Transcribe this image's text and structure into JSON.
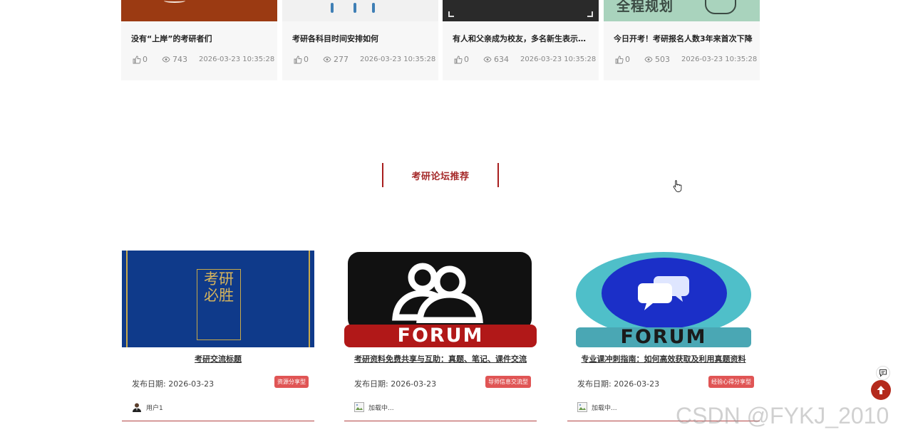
{
  "news": [
    {
      "title": "没有“上岸”的考研者们",
      "likes": "0",
      "views": "743",
      "date": "2026-03-23 10:35:28"
    },
    {
      "title": "考研各科目时间安排如何",
      "likes": "0",
      "views": "277",
      "date": "2026-03-23 10:35:28"
    },
    {
      "title": "有人和父亲成为校友，多名新生表示要...",
      "likes": "0",
      "views": "634",
      "date": "2026-03-23 10:35:28"
    },
    {
      "title": "今日开考！考研报名人数3年来首次下降",
      "likes": "0",
      "views": "503",
      "date": "2026-03-23 10:35:28"
    }
  ],
  "news_thumb_text": "全程规划",
  "section": {
    "title": "考研论坛推荐"
  },
  "forum": [
    {
      "title": "考研交流标题",
      "date_label": "发布日期: 2026-03-23",
      "tag": "资源分享型",
      "author": "用户1",
      "cover_text": "考研必胜"
    },
    {
      "title": "考研资料免费共享与互助：真题、笔记、课件交流",
      "date_label": "发布日期: 2026-03-23",
      "tag": "导师信息交流型",
      "author": "加载中...",
      "cover_text": "FORUM"
    },
    {
      "title": "专业课冲刺指南：如何高效获取及利用真题资料",
      "date_label": "发布日期: 2026-03-23",
      "tag": "经验心得分享型",
      "author": "加载中...",
      "cover_text": "FORUM"
    }
  ],
  "icons": {
    "like": "thumb-up-icon",
    "views": "eye-icon",
    "chat": "chat-icon",
    "back_to_top": "arrow-up-icon"
  },
  "colors": {
    "accent": "#a81e1e",
    "tag": "#e05555",
    "top_button": "#b42a1c"
  },
  "watermark": "CSDN @FYKJ_2010"
}
